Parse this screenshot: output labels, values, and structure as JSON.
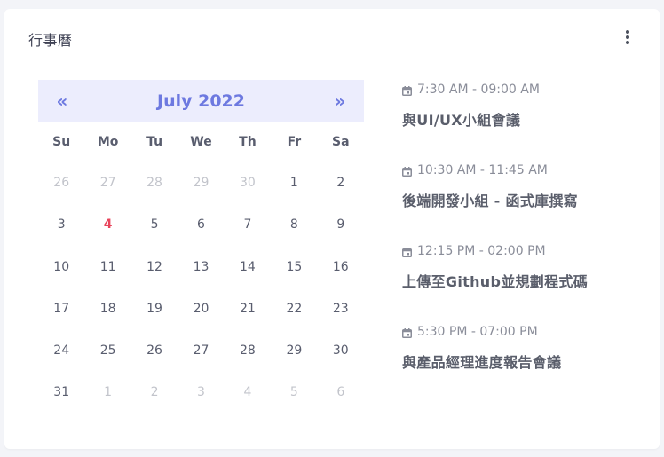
{
  "card": {
    "title": "行事曆",
    "menu_icon": "kebab-vertical-icon"
  },
  "calendar": {
    "prev_label": "«",
    "next_label": "»",
    "month_label": "July 2022",
    "weekdays": [
      "Su",
      "Mo",
      "Tu",
      "We",
      "Th",
      "Fr",
      "Sa"
    ],
    "days": [
      {
        "label": "26",
        "state": "muted"
      },
      {
        "label": "27",
        "state": "muted"
      },
      {
        "label": "28",
        "state": "muted"
      },
      {
        "label": "29",
        "state": "muted"
      },
      {
        "label": "30",
        "state": "muted"
      },
      {
        "label": "1",
        "state": "normal"
      },
      {
        "label": "2",
        "state": "normal"
      },
      {
        "label": "3",
        "state": "normal"
      },
      {
        "label": "4",
        "state": "today"
      },
      {
        "label": "5",
        "state": "normal"
      },
      {
        "label": "6",
        "state": "normal"
      },
      {
        "label": "7",
        "state": "normal"
      },
      {
        "label": "8",
        "state": "normal"
      },
      {
        "label": "9",
        "state": "normal"
      },
      {
        "label": "10",
        "state": "normal"
      },
      {
        "label": "11",
        "state": "normal"
      },
      {
        "label": "12",
        "state": "normal"
      },
      {
        "label": "13",
        "state": "normal"
      },
      {
        "label": "14",
        "state": "normal"
      },
      {
        "label": "15",
        "state": "normal"
      },
      {
        "label": "16",
        "state": "normal"
      },
      {
        "label": "17",
        "state": "normal"
      },
      {
        "label": "18",
        "state": "normal"
      },
      {
        "label": "19",
        "state": "normal"
      },
      {
        "label": "20",
        "state": "normal"
      },
      {
        "label": "21",
        "state": "normal"
      },
      {
        "label": "22",
        "state": "normal"
      },
      {
        "label": "23",
        "state": "normal"
      },
      {
        "label": "24",
        "state": "normal"
      },
      {
        "label": "25",
        "state": "normal"
      },
      {
        "label": "26",
        "state": "normal"
      },
      {
        "label": "27",
        "state": "normal"
      },
      {
        "label": "28",
        "state": "normal"
      },
      {
        "label": "29",
        "state": "normal"
      },
      {
        "label": "30",
        "state": "normal"
      },
      {
        "label": "31",
        "state": "normal"
      },
      {
        "label": "1",
        "state": "muted"
      },
      {
        "label": "2",
        "state": "muted"
      },
      {
        "label": "3",
        "state": "muted"
      },
      {
        "label": "4",
        "state": "muted"
      },
      {
        "label": "5",
        "state": "muted"
      },
      {
        "label": "6",
        "state": "muted"
      }
    ]
  },
  "events": [
    {
      "icon": "calendar-icon",
      "time": "7:30 AM - 09:00 AM",
      "title": "與UI/UX小組會議"
    },
    {
      "icon": "calendar-icon",
      "time": "10:30 AM - 11:45 AM",
      "title": "後端開發小組 - 函式庫撰寫"
    },
    {
      "icon": "calendar-icon",
      "time": "12:15 PM - 02:00 PM",
      "title": "上傳至Github並規劃程式碼"
    },
    {
      "icon": "calendar-icon",
      "time": "5:30 PM - 07:00 PM",
      "title": "與產品經理進度報告會議"
    }
  ],
  "colors": {
    "accent": "#6d79e0",
    "header_bg": "#ecedfd",
    "today": "#e8445b",
    "muted": "#c2c4cb",
    "text": "#595d6e"
  }
}
